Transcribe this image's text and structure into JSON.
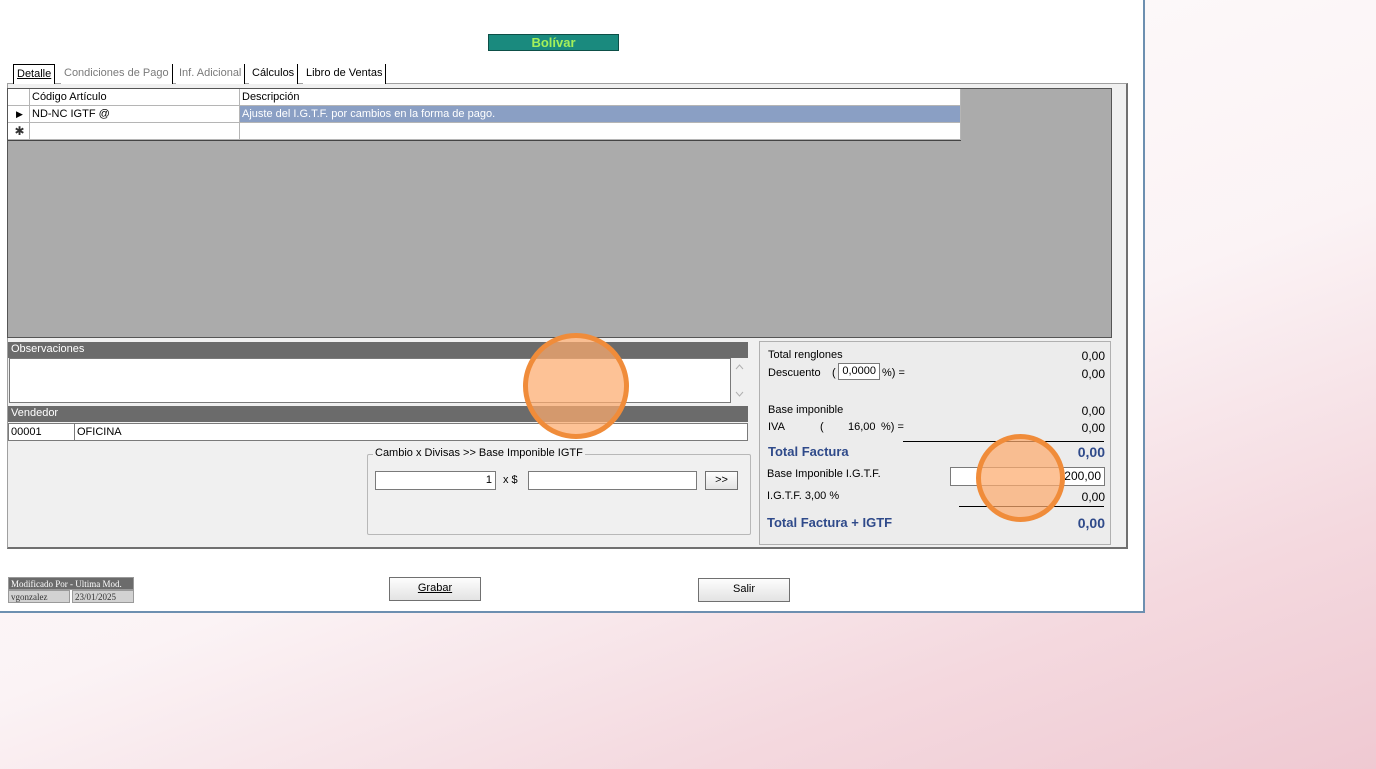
{
  "title_badge": "Bolívar",
  "tabs": [
    {
      "label": "Detalle",
      "state": "active"
    },
    {
      "label": "Condiciones de Pago",
      "state": "disabled"
    },
    {
      "label": "Inf. Adicional",
      "state": "disabled"
    },
    {
      "label": "Cálculos",
      "state": "normal"
    },
    {
      "label": "Libro de Ventas",
      "state": "normal"
    }
  ],
  "grid": {
    "columns": [
      "Código Artículo",
      "Descripción"
    ],
    "rows": [
      {
        "indicator": "▶",
        "codigo": "ND-NC IGTF @",
        "descripcion": "Ajuste del I.G.T.F. por cambios en la forma de pago."
      },
      {
        "indicator": "✱",
        "codigo": "",
        "descripcion": ""
      }
    ]
  },
  "observaciones": {
    "label": "Observaciones",
    "value": ""
  },
  "vendedor": {
    "label": "Vendedor",
    "code": "00001",
    "name": "OFICINA"
  },
  "cambio": {
    "legend": "Cambio x Divisas >> Base Imponible IGTF",
    "rate": "1",
    "times_label": "x $",
    "amount": "",
    "go_button": ">>"
  },
  "totals": {
    "total_renglones_label": "Total renglones",
    "total_renglones": "0,00",
    "descuento_label": "Descuento",
    "descuento_pct": "0,0000",
    "descuento_suffix": "%) =",
    "descuento": "0,00",
    "base_imponible_label": "Base imponible",
    "base_imponible": "0,00",
    "iva_label": "IVA",
    "iva_pct": "16,00",
    "iva_suffix": "%) =",
    "iva": "0,00",
    "total_factura_label": "Total Factura",
    "total_factura": "0,00",
    "base_igtf_label": "Base Imponible I.G.T.F.",
    "base_igtf_value": "200,00",
    "igtf_label": "I.G.T.F. 3,00 %",
    "igtf": "0,00",
    "total_factura_igtf_label": "Total Factura + IGTF",
    "total_factura_igtf": "0,00"
  },
  "footer": {
    "modified_label": "Modificado Por - Ultima Mod.",
    "user": "vgonzalez",
    "date": "23/01/2025",
    "save_button": "Grabar",
    "exit_button": "Salir"
  },
  "colors": {
    "accent_badge": "#1a8a7e",
    "selected_row": "#8a9fc4",
    "totals_text": "#2f4a8a",
    "click_marker": "#f08c3a"
  }
}
